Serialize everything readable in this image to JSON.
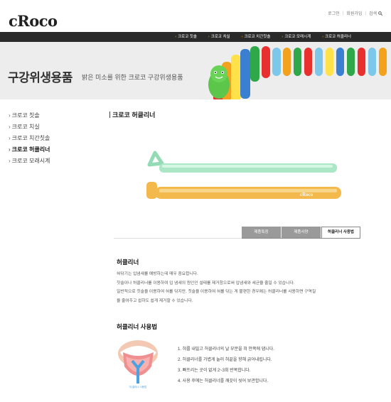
{
  "header": {
    "logo": "cRoco",
    "utility_links": [
      "로그인",
      "회원가입",
      "검색"
    ]
  },
  "nav": {
    "items": [
      "크로코 칫솔",
      "크로코 치실",
      "크로코 치간칫솔",
      "크로코 모래시계",
      "크로코 허클리너"
    ]
  },
  "banner": {
    "title": "구강위생용품",
    "subtitle": "밝은 미소를 위한 크로코 구강위생용품"
  },
  "sidebar": {
    "items": [
      {
        "label": "크로코 칫솔",
        "active": false
      },
      {
        "label": "크로코 치실",
        "active": false
      },
      {
        "label": "크로코 치간칫솔",
        "active": false
      },
      {
        "label": "크로코 허클리너",
        "active": true
      },
      {
        "label": "크로코 모래시계",
        "active": false
      }
    ]
  },
  "main": {
    "page_title": "크로코 허클리너",
    "product_brand": "cRoco",
    "tabs": [
      {
        "label": "제품특징",
        "active": false
      },
      {
        "label": "제품사양",
        "active": false
      },
      {
        "label": "허클리너 사용법",
        "active": true
      }
    ],
    "section1_heading": "허클리너",
    "section1_lines": [
      "혀닦기는 입냄새를 예방하는데 매우 중요합니다.",
      "칫솔이나 허클리너를 이용하여 입 냄새의 원인인 설태를 제거함으로써 입냄새와 세균을 줄일 수 있습니다.",
      "일반적으로 칫솔을 이용하여 혀를 닦지만, 칫솔을 이용하여 혀를 닦는 게 불편한 경우에는 허클리너를 사용하면 구역질",
      "을 줄여주고 쉽하도 쉽게 제거할 수 있습니다."
    ],
    "section2_heading": "허클리너 사용법",
    "image_caption": "혀 클리너 사용법",
    "steps": [
      "1. 혀를 내밀고 허클리너의 날 부분을 혀 안쪽에 댑니다.",
      "2. 허클리너를 가볍게 눌러 혀끝을 향해 긁어내립니다.",
      "3. 빠뜨리는 곳이 없게 2~3회 반복합니다.",
      "4. 사용 후에는 허클리너를 깨끗이 씻어 보관합니다."
    ]
  },
  "colors": {
    "nav_bg": "#2a2a2a",
    "nav_bullet": "#f0a000",
    "banner_bg": "#ededed",
    "tab_inactive": "#9a9a9a",
    "cleaner_green": "#7fd6a8",
    "cleaner_orange": "#f2b23a"
  }
}
